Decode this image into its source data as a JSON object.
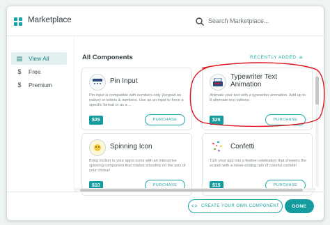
{
  "header": {
    "logo_icon": "grid-icon",
    "title": "Marketplace",
    "search_placeholder": "Search Marketplace..."
  },
  "sidebar": {
    "items": [
      {
        "label": "View All",
        "icon": "store-icon",
        "active": true
      },
      {
        "label": "Free",
        "icon": "dollar-icon",
        "active": false
      },
      {
        "label": "Premium",
        "icon": "dollar-icon",
        "active": false
      }
    ]
  },
  "main": {
    "section_title": "All Components",
    "sort_label": "RECENTLY ADDED",
    "cards": [
      {
        "name": "Pin Input",
        "description": "Pin input is compatible with numbers-only (keypad on native) or letters & numbers. Use as an input to force a specific format or as a ...",
        "price": "$25",
        "button": "PURCHASE",
        "icon": "pin-input-icon"
      },
      {
        "name": "Typewriter Text Animation",
        "description": "Animate your text with a typewriter animation. Add up to 8 alternate text options.",
        "price": "$25",
        "button": "PURCHASE",
        "icon": "typewriter-icon"
      },
      {
        "name": "Spinning Icon",
        "description": "Bring motion to your app's icons with an interactive spinning component that rotates smoothly on the axis of your choice!",
        "price": "$10",
        "button": "PURCHASE",
        "icon": "spinning-icon"
      },
      {
        "name": "Confetti",
        "description": "Turn your app into a festive celebration that showers the screen with a never-ending rain of colorful confetti!",
        "price": "$15",
        "button": "PURCHASE",
        "icon": "confetti-icon"
      }
    ]
  },
  "footer": {
    "create_label": "CREATE YOUR OWN COMPONENT",
    "done_label": "DONE"
  },
  "colors": {
    "accent": "#1aa3a6",
    "highlight": "#e0131f"
  }
}
